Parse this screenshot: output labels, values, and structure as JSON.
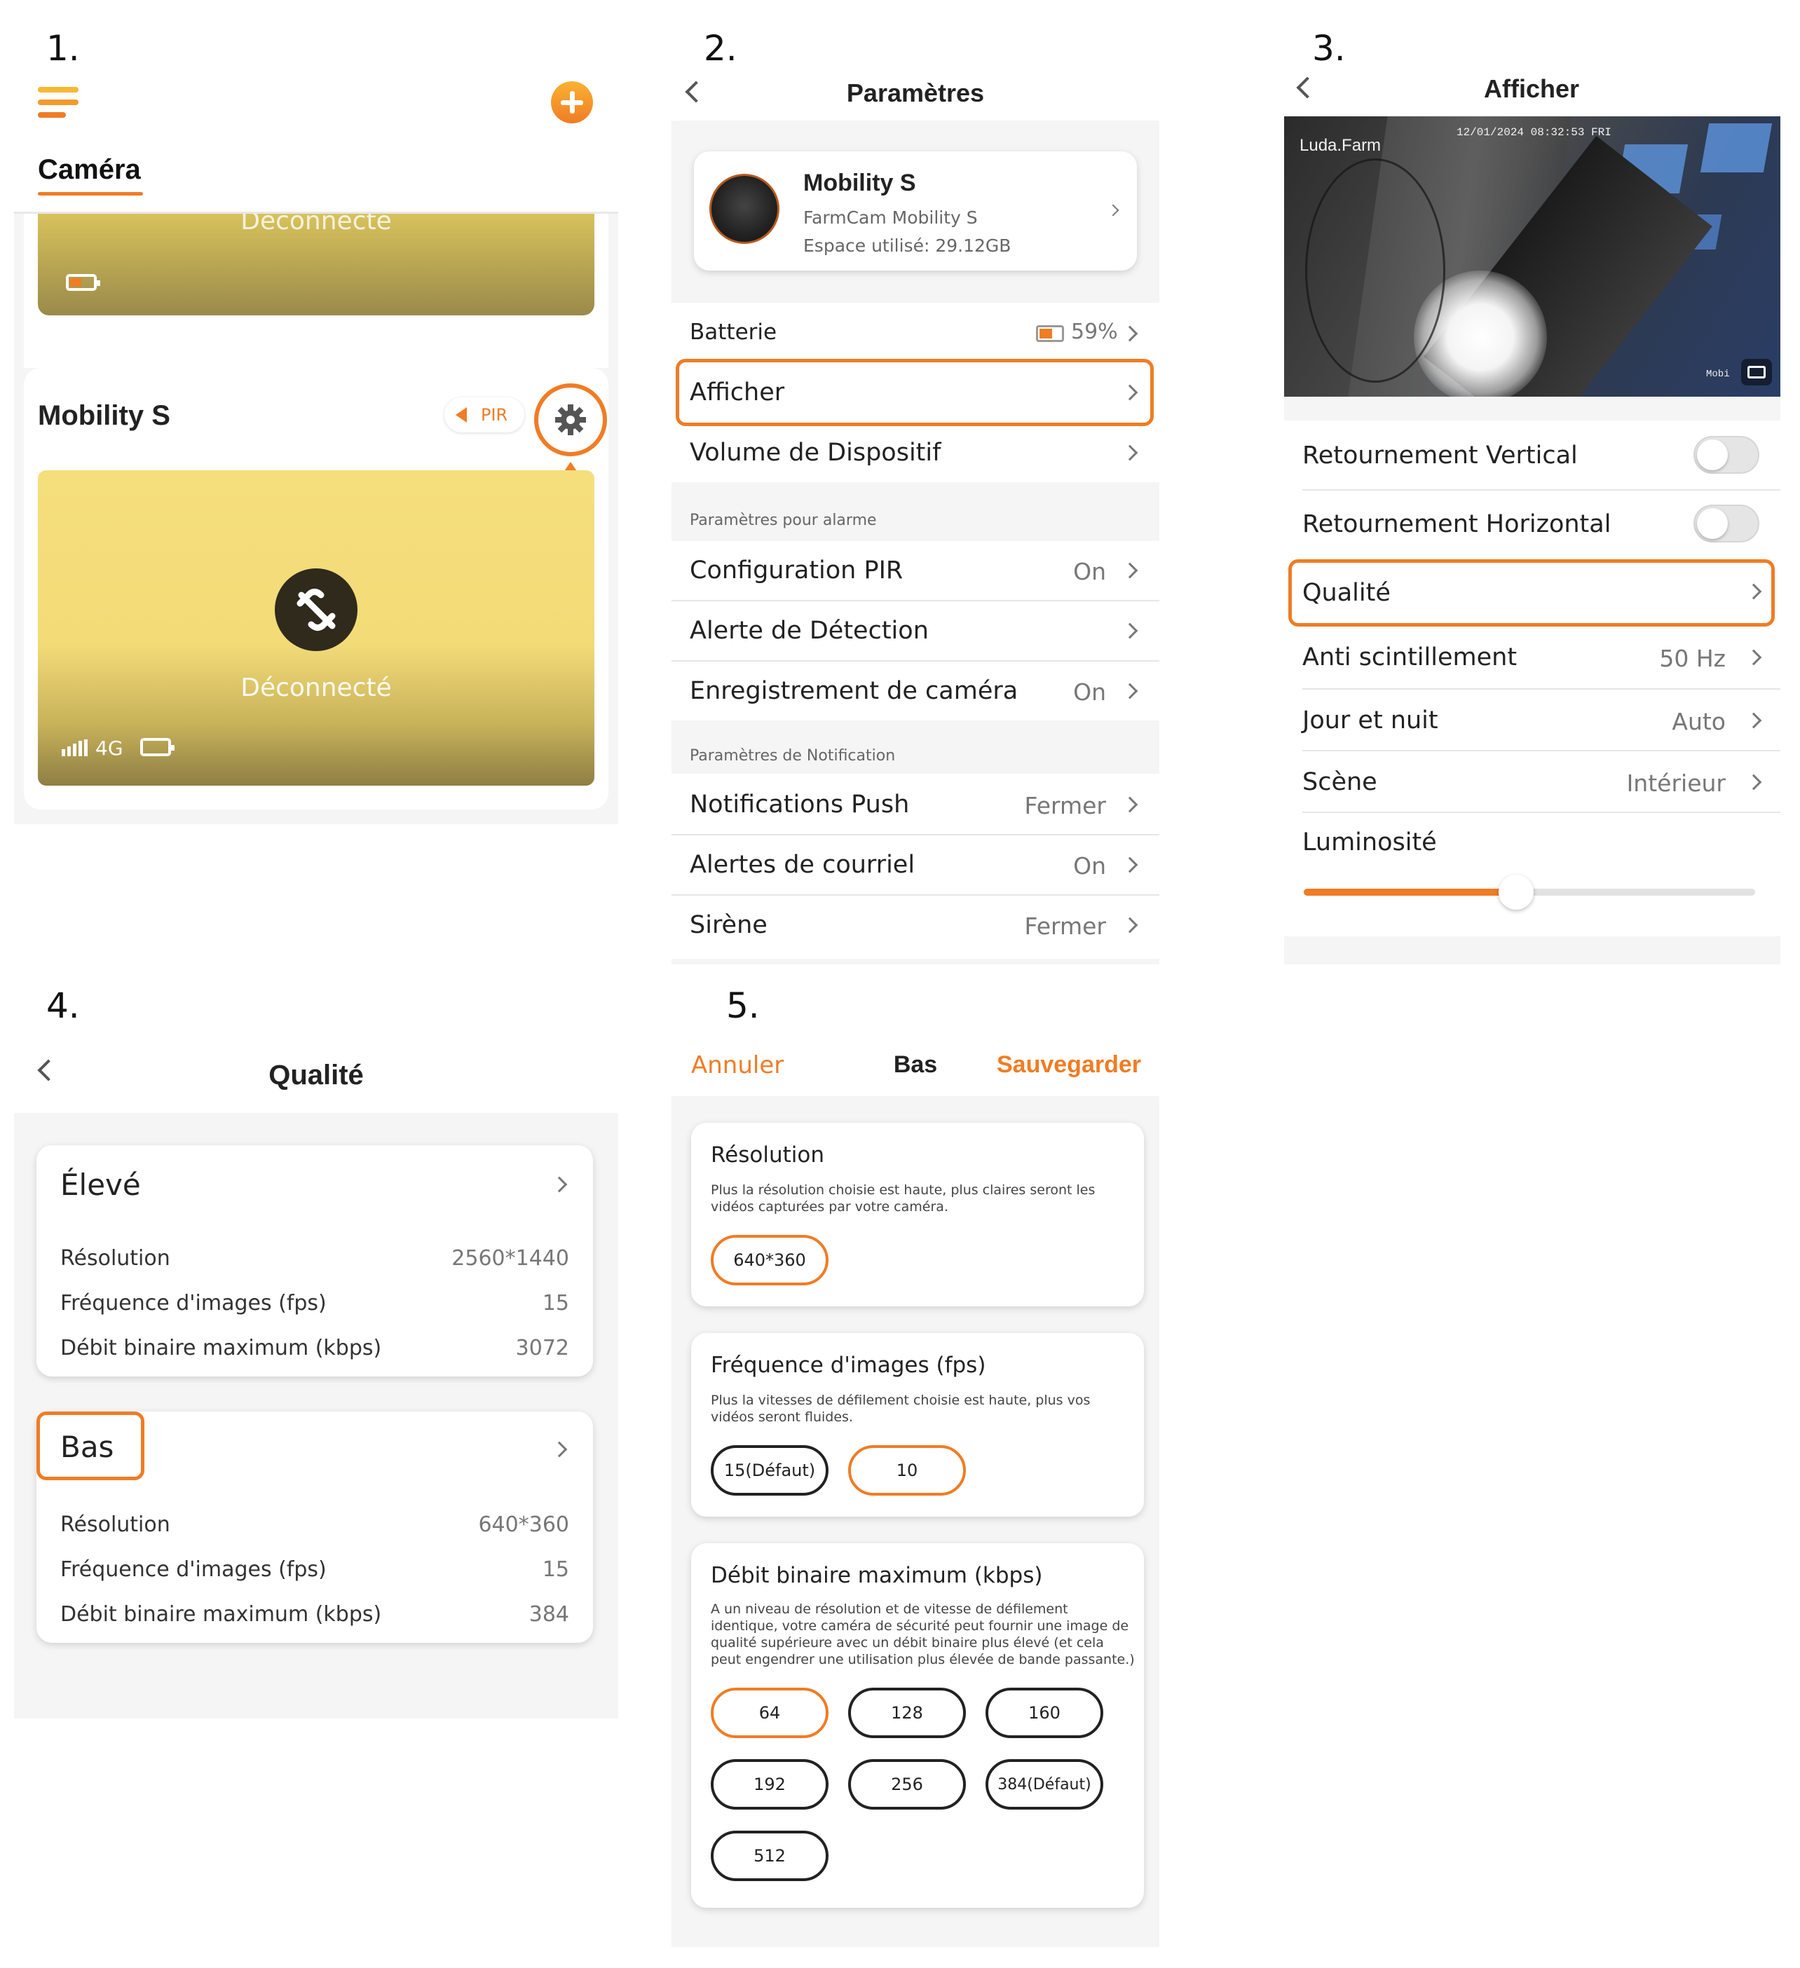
{
  "steps": {
    "s1": "1.",
    "s2": "2.",
    "s3": "3.",
    "s4": "4.",
    "s5": "5."
  },
  "panel1": {
    "tab": "Caméra",
    "disconnected_top": "Déconnecté",
    "device_name": "Mobility S",
    "pir_badge": "PIR",
    "disconnected_label": "Déconnecté",
    "network": "4G",
    "accent": "#f07c24",
    "card_color": "#f2dc7a"
  },
  "panel2": {
    "title": "Paramètres",
    "device_name": "Mobility S",
    "device_model": "FarmCam Mobility S",
    "storage": "Espace utilisé: 29.12GB",
    "battery_label": "Batterie",
    "battery_value": "59%",
    "display_label": "Afficher",
    "volume_label": "Volume de Dispositif",
    "alarm_section": "Paramètres pour alarme",
    "pir_label": "Configuration PIR",
    "pir_value": "On",
    "detection_label": "Alerte de Détection",
    "recording_label": "Enregistrement de caméra",
    "recording_value": "On",
    "notif_section": "Paramètres de Notification",
    "push_label": "Notifications Push",
    "push_value": "Fermer",
    "email_label": "Alertes de courriel",
    "email_value": "On",
    "siren_label": "Sirène",
    "siren_value": "Fermer"
  },
  "panel3": {
    "title": "Afficher",
    "watermark": "Luda.Farm",
    "timestamp": "12/01/2024 08:32:53 FRI",
    "overlay_corner": "Mobi",
    "vflip_label": "Retournement Vertical",
    "hflip_label": "Retournement Horizontal",
    "quality_label": "Qualité",
    "flicker_label": "Anti scintillement",
    "flicker_value": "50 Hz",
    "daynight_label": "Jour et nuit",
    "daynight_value": "Auto",
    "scene_label": "Scène",
    "scene_value": "Intérieur",
    "brightness_label": "Luminosité",
    "brightness_level": 0.47
  },
  "panel4": {
    "title": "Qualité",
    "high": {
      "name": "Élevé",
      "res_label": "Résolution",
      "res_value": "2560*1440",
      "fps_label": "Fréquence d'images (fps)",
      "fps_value": "15",
      "bitrate_label": "Débit binaire maximum (kbps)",
      "bitrate_value": "3072"
    },
    "low": {
      "name": "Bas",
      "res_label": "Résolution",
      "res_value": "640*360",
      "fps_label": "Fréquence d'images (fps)",
      "fps_value": "15",
      "bitrate_label": "Débit binaire maximum (kbps)",
      "bitrate_value": "384"
    }
  },
  "panel5": {
    "cancel": "Annuler",
    "title": "Bas",
    "save": "Sauvegarder",
    "res_title": "Résolution",
    "res_desc": "Plus la résolution choisie est haute, plus claires seront les vidéos capturées par votre caméra.",
    "res_options": [
      "640*360"
    ],
    "fps_title": "Fréquence d'images (fps)",
    "fps_desc": "Plus la vitesses de défilement choisie est haute, plus vos vidéos seront fluides.",
    "fps_options": [
      "15(Défaut)",
      "10"
    ],
    "bitrate_title": "Débit binaire maximum (kbps)",
    "bitrate_desc": "A un niveau de résolution et de vitesse de défilement identique, votre caméra de sécurité peut fournir une image de qualité supérieure avec un débit binaire plus élevé (et cela peut engendrer une utilisation plus élevée de bande passante.)",
    "bitrate_options": [
      "64",
      "128",
      "160",
      "192",
      "256",
      "384(Défaut)",
      "512"
    ]
  }
}
